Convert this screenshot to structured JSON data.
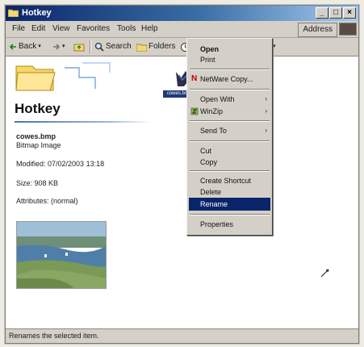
{
  "window": {
    "title": "Hotkey",
    "controls": [
      "_",
      "□",
      "×"
    ]
  },
  "menubar": {
    "items": [
      "File",
      "Edit",
      "View",
      "Favorites",
      "Tools",
      "Help"
    ],
    "address_label": "Address"
  },
  "toolbar": {
    "back_label": "Back",
    "search_label": "Search",
    "folders_label": "Folders"
  },
  "folder_pane": {
    "title": "Hotkey",
    "file_name": "cowes.bmp",
    "file_type": "Bitmap Image",
    "modified": "Modified: 07/02/2003 13:18",
    "size": "Size: 908 KB",
    "attributes": "Attributes: (normal)"
  },
  "context_menu": {
    "open": "Open",
    "print": "Print",
    "netware_copy": "NetWare Copy...",
    "open_with": "Open With",
    "winzip": "WinZip",
    "send_to": "Send To",
    "cut": "Cut",
    "copy": "Copy",
    "create_shortcut": "Create Shortcut",
    "delete": "Delete",
    "rename": "Rename",
    "properties": "Properties",
    "submenu_arrow": "›"
  },
  "status_bar": {
    "text": "Renames the selected item."
  },
  "colors": {
    "title_gradient_start": "#0a246a",
    "menu_selection": "#0a246a",
    "chrome": "#d4d0c8"
  }
}
